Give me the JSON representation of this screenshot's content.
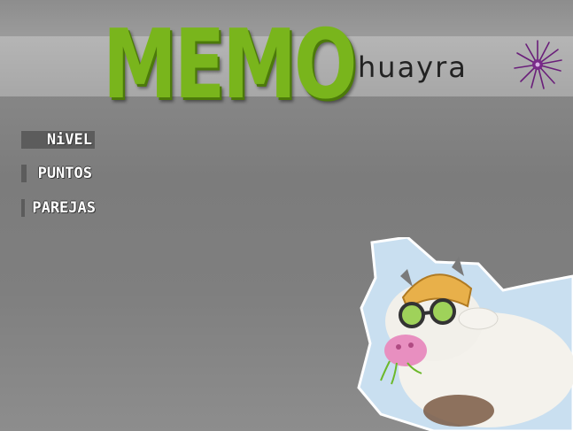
{
  "game": {
    "title": "MEMO",
    "brand": "huayra",
    "title_color": "#79b51c"
  },
  "hud": {
    "level_label": "NiVEL",
    "points_label": "PUNTOS",
    "pairs_label": "PAREJAS"
  },
  "icons": {
    "brand_mark": "starburst-icon",
    "mascot": "cow-mascot-illustration"
  },
  "colors": {
    "background": "#808080",
    "header_band": "#b0b0b0",
    "accent_green": "#79b51c",
    "accent_purple": "#7a2a8a"
  }
}
